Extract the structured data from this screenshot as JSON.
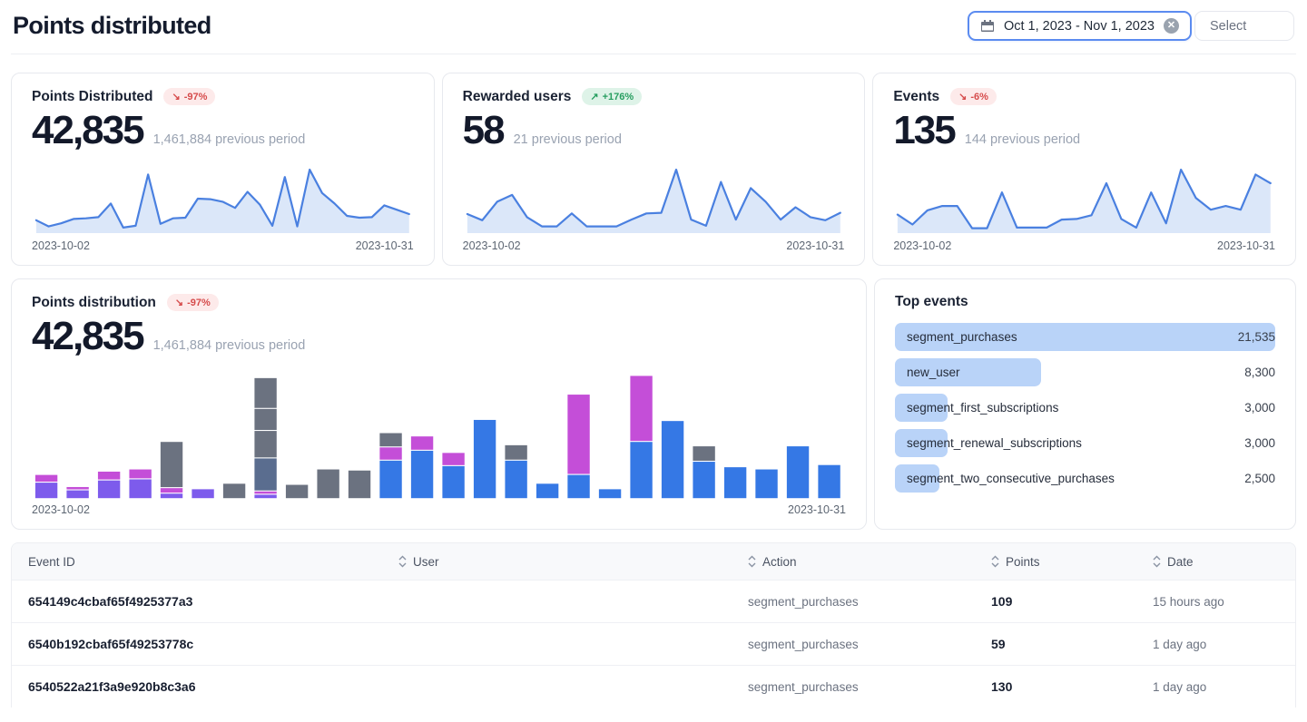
{
  "page": {
    "title": "Points distributed"
  },
  "header": {
    "date_range": "Oct 1, 2023 - Nov 1, 2023",
    "clear_glyph": "✕",
    "select_label": "Select"
  },
  "colors": {
    "spark_line": "#4a80e0",
    "spark_fill": "#dbe7f9",
    "top_events_bar": "#b9d3f8",
    "badge_down_bg": "#fdeaea",
    "badge_down_text": "#d64b4b",
    "badge_up_bg": "#def3e8",
    "badge_up_text": "#279e60",
    "accent_border": "#5b8bf0"
  },
  "stat_cards": [
    {
      "title": "Points Distributed",
      "badge_arrow": "↘",
      "badge": "-97%",
      "value": "42,835",
      "previous": "1,461,884 previous period",
      "date_start": "2023-10-02",
      "date_end": "2023-10-31"
    },
    {
      "title": "Rewarded users",
      "badge_arrow": "↗",
      "badge": "+176%",
      "value": "58",
      "previous": "21 previous period",
      "date_start": "2023-10-02",
      "date_end": "2023-10-31"
    },
    {
      "title": "Events",
      "badge_arrow": "↘",
      "badge": "-6%",
      "value": "135",
      "previous": "144 previous period",
      "date_start": "2023-10-02",
      "date_end": "2023-10-31"
    }
  ],
  "distribution_card": {
    "title": "Points distribution",
    "badge_arrow": "↘",
    "badge": "-97%",
    "value": "42,835",
    "previous": "1,461,884 previous period",
    "date_start": "2023-10-02",
    "date_end": "2023-10-31"
  },
  "top_events": {
    "title": "Top events",
    "rows": [
      {
        "label": "segment_purchases",
        "value": "21,535"
      },
      {
        "label": "new_user",
        "value": "8,300"
      },
      {
        "label": "segment_first_subscriptions",
        "value": "3,000"
      },
      {
        "label": "segment_renewal_subscriptions",
        "value": "3,000"
      },
      {
        "label": "segment_two_consecutive_purchases",
        "value": "2,500"
      }
    ]
  },
  "table": {
    "columns": [
      "Event ID",
      "User",
      "Action",
      "Points",
      "Date"
    ],
    "rows": [
      {
        "event_id": "654149c4cbaf65f4925377a3",
        "user": "",
        "action": "segment_purchases",
        "points": "109",
        "date": "15 hours ago"
      },
      {
        "event_id": "6540b192cbaf65f49253778c",
        "user": "",
        "action": "segment_purchases",
        "points": "59",
        "date": "1 day ago"
      },
      {
        "event_id": "6540522a21f3a9e920b8c3a6",
        "user": "",
        "action": "segment_purchases",
        "points": "130",
        "date": "1 day ago"
      }
    ]
  },
  "chart_data": [
    {
      "type": "area",
      "title": "Points Distributed daily sparkline",
      "x_start": "2023-10-02",
      "x_end": "2023-10-31",
      "ylim": [
        0,
        100
      ],
      "values": [
        18,
        8,
        13,
        20,
        21,
        23,
        45,
        6,
        9,
        92,
        12,
        21,
        22,
        53,
        52,
        48,
        38,
        64,
        43,
        9,
        88,
        8,
        100,
        62,
        45,
        25,
        22,
        23,
        42,
        35,
        28
      ]
    },
    {
      "type": "area",
      "title": "Rewarded users daily sparkline",
      "x_start": "2023-10-02",
      "x_end": "2023-10-31",
      "ylim": [
        0,
        100
      ],
      "values": [
        28,
        18,
        48,
        59,
        23,
        8,
        8,
        29,
        8,
        8,
        8,
        19,
        29,
        30,
        100,
        19,
        9,
        80,
        19,
        70,
        48,
        19,
        39,
        23,
        18,
        30
      ]
    },
    {
      "type": "area",
      "title": "Events daily sparkline",
      "x_start": "2023-10-02",
      "x_end": "2023-10-31",
      "ylim": [
        0,
        100
      ],
      "values": [
        27,
        11,
        34,
        41,
        41,
        5,
        5,
        63,
        6,
        6,
        6,
        19,
        20,
        26,
        78,
        20,
        6,
        63,
        13,
        100,
        54,
        35,
        41,
        35,
        92,
        78
      ]
    },
    {
      "type": "stacked-bar",
      "title": "Points distribution by day",
      "x_start": "2023-10-02",
      "x_end": "2023-10-31",
      "ylim": [
        0,
        115
      ],
      "palette": {
        "v": "#7d5bec",
        "m": "#c44ed8",
        "b": "#3578e5",
        "g": "#6b7280",
        "s": "#5a6d8f"
      },
      "bars": [
        {
          "segments": [
            [
              "v",
              15
            ],
            [
              "m",
              7
            ]
          ]
        },
        {
          "segments": [
            [
              "v",
              8
            ],
            [
              "m",
              3
            ]
          ]
        },
        {
          "segments": [
            [
              "v",
              17
            ],
            [
              "m",
              8
            ]
          ]
        },
        {
          "segments": [
            [
              "v",
              18
            ],
            [
              "m",
              9
            ]
          ]
        },
        {
          "segments": [
            [
              "v",
              5
            ],
            [
              "m",
              5
            ],
            [
              "g",
              42
            ]
          ]
        },
        {
          "segments": [
            [
              "v",
              9
            ]
          ]
        },
        {
          "segments": [
            [
              "g",
              14
            ]
          ]
        },
        {
          "segments": [
            [
              "v",
              4
            ],
            [
              "m",
              3
            ],
            [
              "s",
              30
            ],
            [
              "g",
              25
            ],
            [
              "g",
              20
            ],
            [
              "g",
              28
            ]
          ]
        },
        {
          "segments": [
            [
              "g",
              13
            ]
          ]
        },
        {
          "segments": [
            [
              "g",
              27
            ]
          ]
        },
        {
          "segments": [
            [
              "g",
              26
            ]
          ]
        },
        {
          "segments": [
            [
              "b",
              35
            ],
            [
              "m",
              12
            ],
            [
              "g",
              13
            ]
          ]
        },
        {
          "segments": [
            [
              "b",
              44
            ],
            [
              "m",
              13
            ]
          ]
        },
        {
          "segments": [
            [
              "b",
              30
            ],
            [
              "m",
              12
            ]
          ]
        },
        {
          "segments": [
            [
              "b",
              72
            ]
          ]
        },
        {
          "segments": [
            [
              "b",
              35
            ],
            [
              "g",
              14
            ]
          ]
        },
        {
          "segments": [
            [
              "b",
              14
            ]
          ]
        },
        {
          "segments": [
            [
              "b",
              22
            ],
            [
              "m",
              73
            ]
          ]
        },
        {
          "segments": [
            [
              "b",
              9
            ]
          ]
        },
        {
          "segments": [
            [
              "b",
              52
            ],
            [
              "m",
              60
            ]
          ]
        },
        {
          "segments": [
            [
              "b",
              71
            ]
          ]
        },
        {
          "segments": [
            [
              "b",
              34
            ],
            [
              "g",
              14
            ]
          ]
        },
        {
          "segments": [
            [
              "b",
              29
            ]
          ]
        },
        {
          "segments": [
            [
              "b",
              27
            ]
          ]
        },
        {
          "segments": [
            [
              "b",
              48
            ]
          ]
        },
        {
          "segments": [
            [
              "b",
              31
            ]
          ]
        }
      ]
    },
    {
      "type": "bar",
      "title": "Top events",
      "orientation": "horizontal",
      "categories": [
        "segment_purchases",
        "new_user",
        "segment_first_subscriptions",
        "segment_renewal_subscriptions",
        "segment_two_consecutive_purchases"
      ],
      "values": [
        21535,
        8300,
        3000,
        3000,
        2500
      ]
    }
  ]
}
